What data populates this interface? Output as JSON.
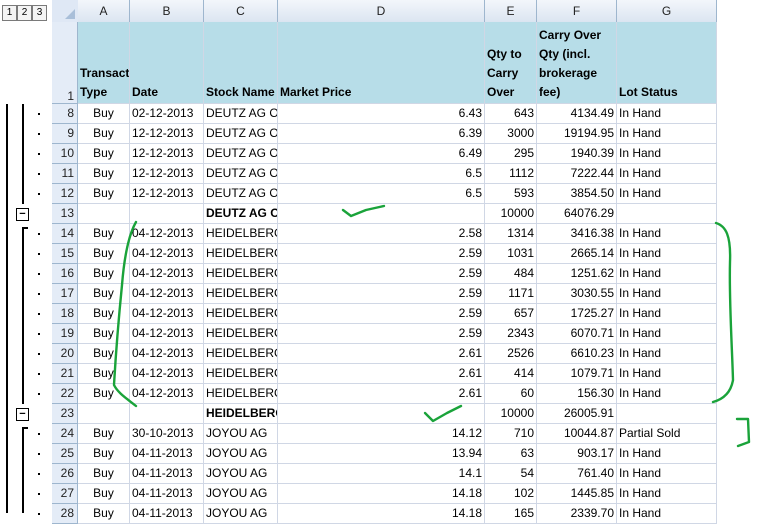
{
  "outline": {
    "levels": [
      "1",
      "2",
      "3"
    ]
  },
  "columns": [
    "A",
    "B",
    "C",
    "D",
    "E",
    "F",
    "G"
  ],
  "header_row": {
    "row_number": "1",
    "cells": [
      "Transaction Type",
      "Date",
      "Stock Name",
      "Market Price",
      "Qty to Carry Over",
      "Amount of Carry Over Qty (incl. brokerage fee)",
      "Lot Status"
    ]
  },
  "rows": [
    {
      "n": "8",
      "type": "Buy",
      "date": "02-12-2013",
      "stock": "DEUTZ AG O.N.",
      "price": "6.43",
      "qty": "643",
      "amount": "4134.49",
      "status": "In Hand",
      "total": false
    },
    {
      "n": "9",
      "type": "Buy",
      "date": "12-12-2013",
      "stock": "DEUTZ AG O.N.",
      "price": "6.39",
      "qty": "3000",
      "amount": "19194.95",
      "status": "In Hand",
      "total": false
    },
    {
      "n": "10",
      "type": "Buy",
      "date": "12-12-2013",
      "stock": "DEUTZ AG O.N.",
      "price": "6.49",
      "qty": "295",
      "amount": "1940.39",
      "status": "In Hand",
      "total": false
    },
    {
      "n": "11",
      "type": "Buy",
      "date": "12-12-2013",
      "stock": "DEUTZ AG O.N.",
      "price": "6.5",
      "qty": "1112",
      "amount": "7222.44",
      "status": "In Hand",
      "total": false
    },
    {
      "n": "12",
      "type": "Buy",
      "date": "12-12-2013",
      "stock": "DEUTZ AG O.N.",
      "price": "6.5",
      "qty": "593",
      "amount": "3854.50",
      "status": "In Hand",
      "total": false
    },
    {
      "n": "13",
      "type": "",
      "date": "",
      "stock": "DEUTZ AG O.N. Total",
      "price": "",
      "qty": "10000",
      "amount": "64076.29",
      "status": "",
      "total": true
    },
    {
      "n": "14",
      "type": "Buy",
      "date": "04-12-2013",
      "stock": "HEIDELBERG.DRUCKMA.O.N.",
      "price": "2.58",
      "qty": "1314",
      "amount": "3416.38",
      "status": "In Hand",
      "total": false
    },
    {
      "n": "15",
      "type": "Buy",
      "date": "04-12-2013",
      "stock": "HEIDELBERG.DRUCKMA.O.N.",
      "price": "2.59",
      "qty": "1031",
      "amount": "2665.14",
      "status": "In Hand",
      "total": false
    },
    {
      "n": "16",
      "type": "Buy",
      "date": "04-12-2013",
      "stock": "HEIDELBERG.DRUCKMA.O.N.",
      "price": "2.59",
      "qty": "484",
      "amount": "1251.62",
      "status": "In Hand",
      "total": false
    },
    {
      "n": "17",
      "type": "Buy",
      "date": "04-12-2013",
      "stock": "HEIDELBERG.DRUCKMA.O.N.",
      "price": "2.59",
      "qty": "1171",
      "amount": "3030.55",
      "status": "In Hand",
      "total": false
    },
    {
      "n": "18",
      "type": "Buy",
      "date": "04-12-2013",
      "stock": "HEIDELBERG.DRUCKMA.O.N.",
      "price": "2.59",
      "qty": "657",
      "amount": "1725.27",
      "status": "In Hand",
      "total": false
    },
    {
      "n": "19",
      "type": "Buy",
      "date": "04-12-2013",
      "stock": "HEIDELBERG.DRUCKMA.O.N.",
      "price": "2.59",
      "qty": "2343",
      "amount": "6070.71",
      "status": "In Hand",
      "total": false
    },
    {
      "n": "20",
      "type": "Buy",
      "date": "04-12-2013",
      "stock": "HEIDELBERG.DRUCKMA.O.N.",
      "price": "2.61",
      "qty": "2526",
      "amount": "6610.23",
      "status": "In Hand",
      "total": false
    },
    {
      "n": "21",
      "type": "Buy",
      "date": "04-12-2013",
      "stock": "HEIDELBERG.DRUCKMA.O.N.",
      "price": "2.61",
      "qty": "414",
      "amount": "1079.71",
      "status": "In Hand",
      "total": false
    },
    {
      "n": "22",
      "type": "Buy",
      "date": "04-12-2013",
      "stock": "HEIDELBERG.DRUCKMA.O.N.",
      "price": "2.61",
      "qty": "60",
      "amount": "156.30",
      "status": "In Hand",
      "total": false
    },
    {
      "n": "23",
      "type": "",
      "date": "",
      "stock": "HEIDELBERG.DRUCKMA.O.N. Total",
      "price": "",
      "qty": "10000",
      "amount": "26005.91",
      "status": "",
      "total": true
    },
    {
      "n": "24",
      "type": "Buy",
      "date": "30-10-2013",
      "stock": "JOYOU AG",
      "price": "14.12",
      "qty": "710",
      "amount": "10044.87",
      "status": "Partial Sold",
      "total": false
    },
    {
      "n": "25",
      "type": "Buy",
      "date": "04-11-2013",
      "stock": "JOYOU AG",
      "price": "13.94",
      "qty": "63",
      "amount": "903.17",
      "status": "In Hand",
      "total": false
    },
    {
      "n": "26",
      "type": "Buy",
      "date": "04-11-2013",
      "stock": "JOYOU AG",
      "price": "14.1",
      "qty": "54",
      "amount": "761.40",
      "status": "In Hand",
      "total": false
    },
    {
      "n": "27",
      "type": "Buy",
      "date": "04-11-2013",
      "stock": "JOYOU AG",
      "price": "14.18",
      "qty": "102",
      "amount": "1445.85",
      "status": "In Hand",
      "total": false
    },
    {
      "n": "28",
      "type": "Buy",
      "date": "04-11-2013",
      "stock": "JOYOU AG",
      "price": "14.18",
      "qty": "165",
      "amount": "2339.70",
      "status": "In Hand",
      "total": false
    }
  ],
  "colors": {
    "header_fill": "#b7dde8",
    "annotation_ink": "#1aa33a",
    "selected_col": "#f6c45e"
  }
}
